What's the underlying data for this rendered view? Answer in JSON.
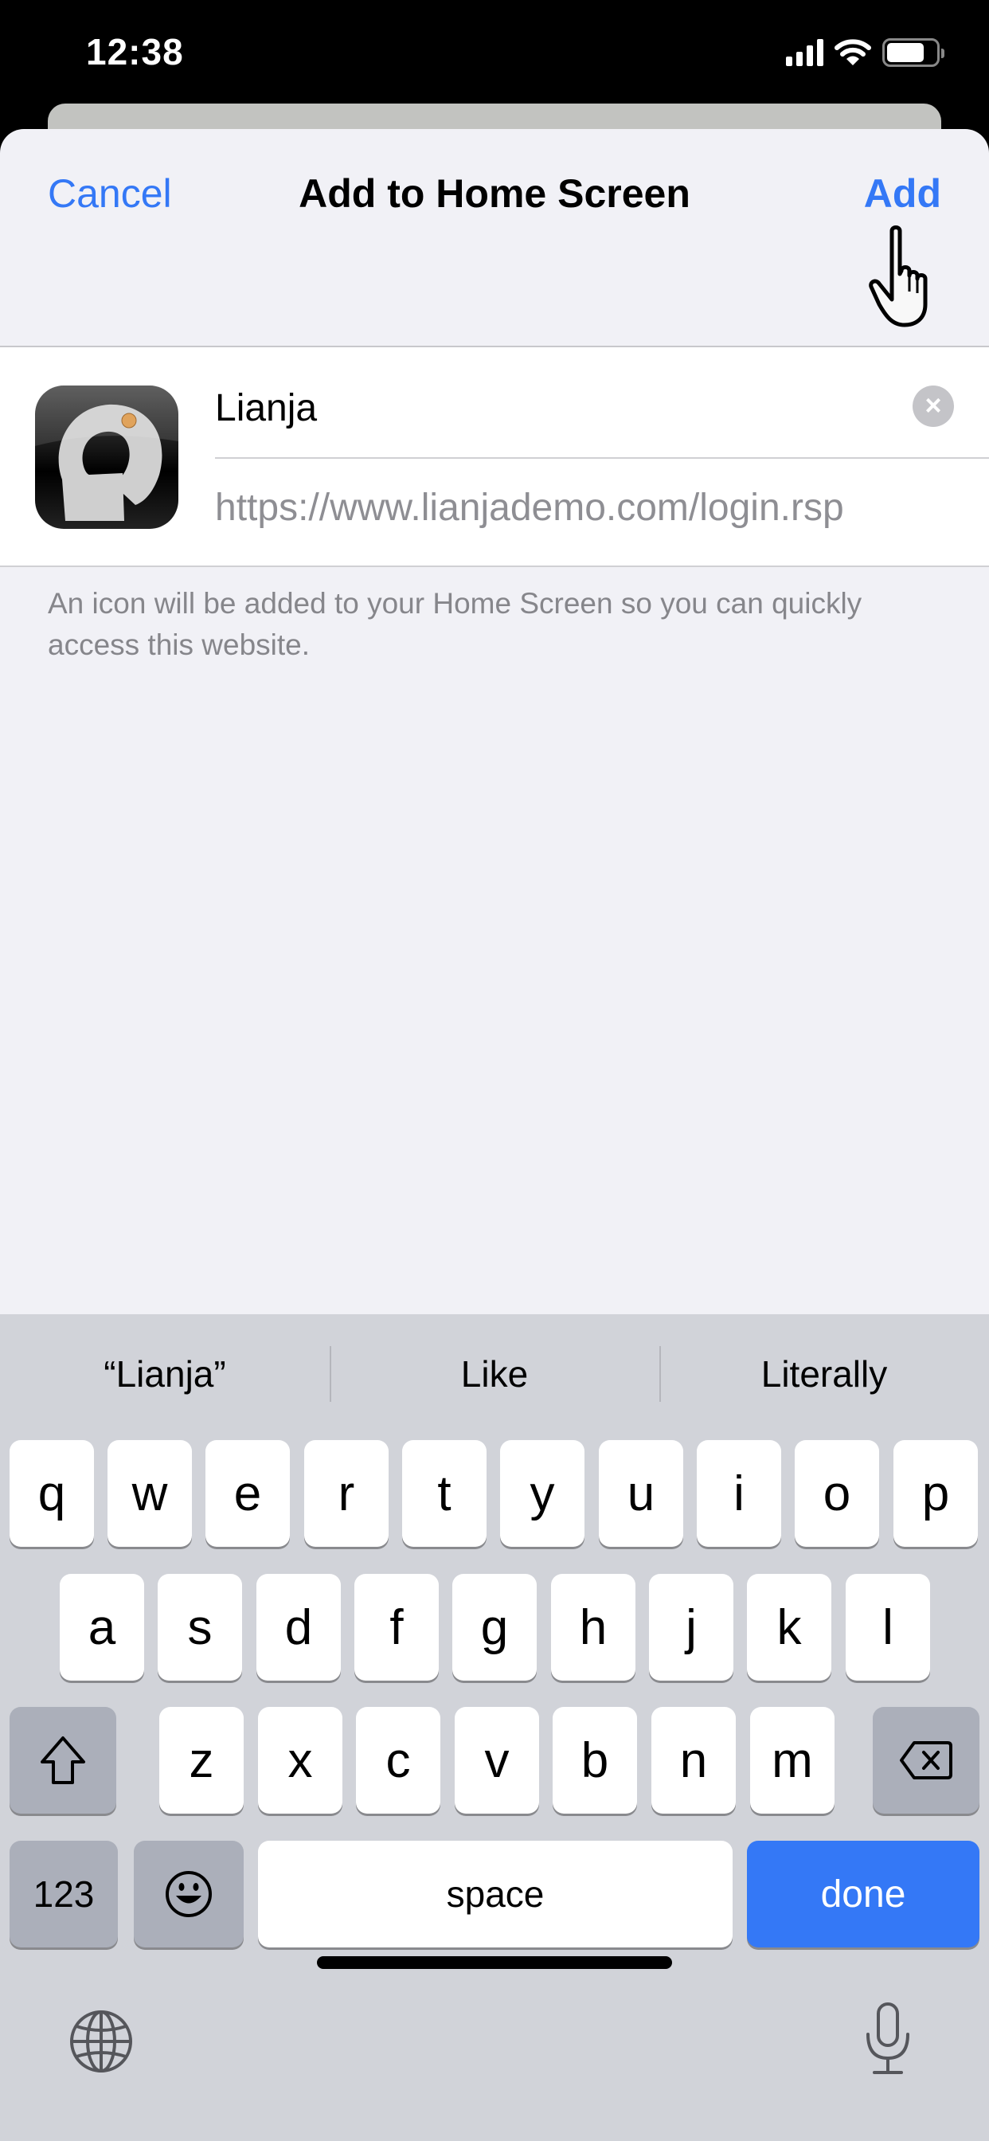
{
  "status_bar": {
    "time": "12:38",
    "icons": [
      "cellular-signal-icon",
      "wifi-icon",
      "battery-icon"
    ]
  },
  "nav": {
    "cancel_label": "Cancel",
    "title": "Add to Home Screen",
    "add_label": "Add"
  },
  "form": {
    "app_icon": "lianja-app-icon",
    "name_value": "Lianja",
    "url": "https://www.lianjademo.com/login.rsp",
    "clear_icon": "clear-text-icon",
    "clear_glyph": "×"
  },
  "footnote": "An icon will be added to your Home Screen so you can quickly access this website.",
  "keyboard": {
    "suggestions": [
      "“Lianja”",
      "Like",
      "Literally"
    ],
    "row1": [
      "q",
      "w",
      "e",
      "r",
      "t",
      "y",
      "u",
      "i",
      "o",
      "p"
    ],
    "row2": [
      "a",
      "s",
      "d",
      "f",
      "g",
      "h",
      "j",
      "k",
      "l"
    ],
    "row3": [
      "z",
      "x",
      "c",
      "v",
      "b",
      "n",
      "m"
    ],
    "numbers_label": "123",
    "space_label": "space",
    "done_label": "done",
    "shift_icon": "shift-icon",
    "delete_icon": "delete-backspace-icon",
    "emoji_icon": "emoji-icon",
    "globe_icon": "globe-icon",
    "mic_icon": "microphone-icon"
  },
  "colors": {
    "accent": "#3478f6",
    "sheet_bg": "#f1f1f6",
    "keyboard_bg": "#d1d3d9"
  }
}
